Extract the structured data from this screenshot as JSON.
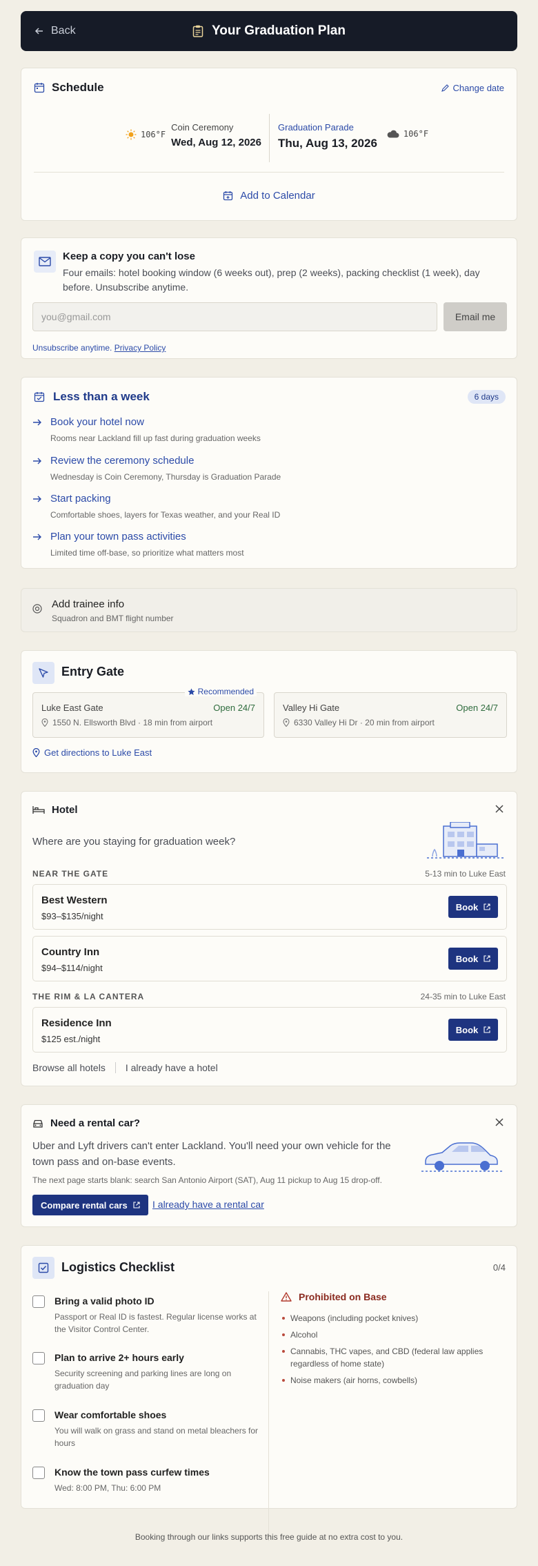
{
  "header": {
    "back_label": "Back",
    "title": "Your Graduation Plan"
  },
  "schedule": {
    "title": "Schedule",
    "change_date": "Change date",
    "events": [
      {
        "temp": "106°F",
        "name": "Coin Ceremony",
        "date": "Wed, Aug 12, 2026"
      },
      {
        "temp": "106°F",
        "name": "Graduation Parade",
        "date": "Thu, Aug 13, 2026"
      }
    ],
    "add_calendar": "Add to Calendar"
  },
  "email": {
    "title": "Keep a copy you can't lose",
    "body": "Four emails: hotel booking window (6 weeks out), prep (2 weeks), packing checklist (1 week), day before. Unsubscribe anytime.",
    "placeholder": "you@gmail.com",
    "button": "Email me",
    "note": "Unsubscribe anytime.",
    "privacy": "Privacy Policy"
  },
  "week": {
    "title": "Less than a week",
    "badge": "6 days",
    "tasks": [
      {
        "title": "Book your hotel now",
        "sub": "Rooms near Lackland fill up fast during graduation weeks"
      },
      {
        "title": "Review the ceremony schedule",
        "sub": "Wednesday is Coin Ceremony, Thursday is Graduation Parade"
      },
      {
        "title": "Start packing",
        "sub": "Comfortable shoes, layers for Texas weather, and your Real ID"
      },
      {
        "title": "Plan your town pass activities",
        "sub": "Limited time off-base, so prioritize what matters most"
      }
    ]
  },
  "trainee": {
    "title": "Add trainee info",
    "sub": "Squadron and BMT flight number"
  },
  "gate": {
    "title": "Entry Gate",
    "recommended": "Recommended",
    "gates": [
      {
        "name": "Luke East Gate",
        "status": "Open 24/7",
        "addr": "1550 N. Ellsworth Blvd · 18 min from airport"
      },
      {
        "name": "Valley Hi Gate",
        "status": "Open 24/7",
        "addr": "6330 Valley Hi Dr · 20 min from airport"
      }
    ],
    "directions": "Get directions to Luke East"
  },
  "hotel": {
    "title": "Hotel",
    "question": "Where are you staying for graduation week?",
    "sections": [
      {
        "label": "NEAR THE GATE",
        "distance": "5-13 min to Luke East"
      },
      {
        "label": "THE RIM & LA CANTERA",
        "distance": "24-35 min to Luke East"
      }
    ],
    "hotels": [
      {
        "name": "Best Western",
        "price": "$93–$135/night"
      },
      {
        "name": "Country Inn",
        "price": "$94–$114/night"
      },
      {
        "name": "Residence Inn",
        "price": "$125 est./night"
      }
    ],
    "book_label": "Book",
    "browse_all": "Browse all hotels",
    "have_hotel": "I already have a hotel"
  },
  "rental": {
    "title": "Need a rental car?",
    "body": "Uber and Lyft drivers can't enter Lackland. You'll need your own vehicle for the town pass and on-base events.",
    "note": "The next page starts blank: search San Antonio Airport (SAT), Aug 11 pickup to Aug 15 drop-off.",
    "compare": "Compare rental cars",
    "have_car": "I already have a rental car"
  },
  "checklist": {
    "title": "Logistics Checklist",
    "count": "0/4",
    "items": [
      {
        "title": "Bring a valid photo ID",
        "sub": "Passport or Real ID is fastest. Regular license works at the Visitor Control Center."
      },
      {
        "title": "Plan to arrive 2+ hours early",
        "sub": "Security screening and parking lines are long on graduation day"
      },
      {
        "title": "Wear comfortable shoes",
        "sub": "You will walk on grass and stand on metal bleachers for hours"
      },
      {
        "title": "Know the town pass curfew times",
        "sub": "Wed: 8:00 PM, Thu: 6:00 PM"
      }
    ],
    "prohibited_title": "Prohibited on Base",
    "prohibited": [
      "Weapons (including pocket knives)",
      "Alcohol",
      "Cannabis, THC vapes, and CBD (federal law applies regardless of home state)",
      "Noise makers (air horns, cowbells)"
    ]
  },
  "footer": "Booking through our links supports this free guide at no extra cost to you."
}
